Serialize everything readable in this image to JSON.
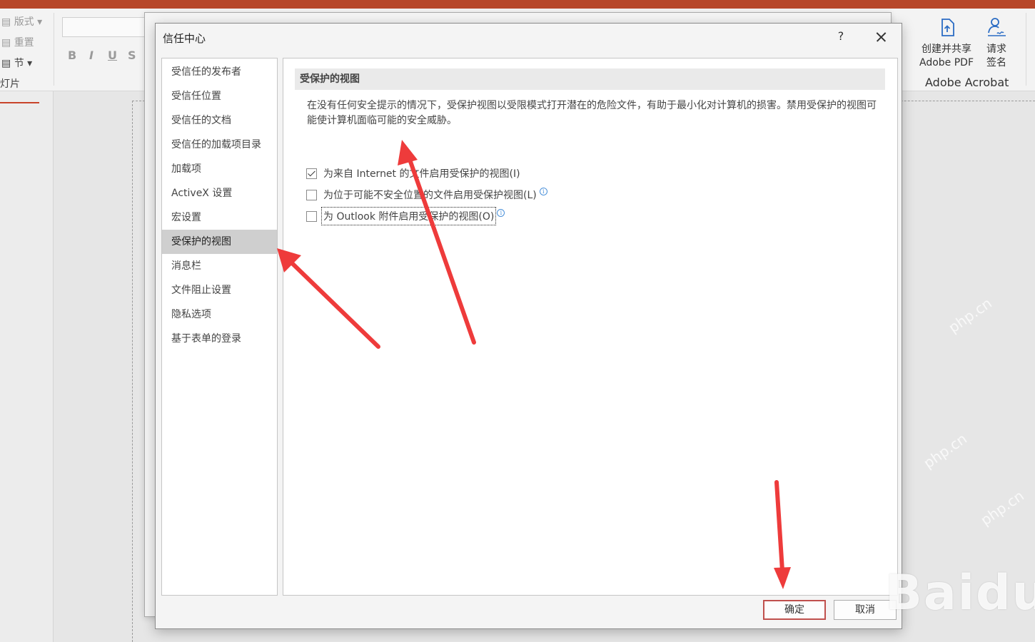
{
  "ribbon": {
    "layout_label": "版式",
    "reset_label": "重置",
    "section_label": "节",
    "slides_label": "灯片",
    "bold_label": "B",
    "italic_label": "I",
    "underline_label": "U",
    "strike_label": "S",
    "create_share_pdf": [
      "创建并共享",
      "Adobe PDF"
    ],
    "request_sign": [
      "请求",
      "签名"
    ],
    "acrobat_group": "Adobe Acrobat"
  },
  "dialog": {
    "title": "信任中心",
    "help": "?",
    "nav_items": [
      "受信任的发布者",
      "受信任位置",
      "受信任的文档",
      "受信任的加载项目录",
      "加载项",
      "ActiveX 设置",
      "宏设置",
      "受保护的视图",
      "消息栏",
      "文件阻止设置",
      "隐私选项",
      "基于表单的登录"
    ],
    "active_nav": "受保护的视图",
    "section_title": "受保护的视图",
    "description": "在没有任何安全提示的情况下，受保护视图以受限模式打开潜在的危险文件，有助于最小化对计算机的损害。禁用受保护的视图可能使计算机面临可能的安全威胁。",
    "options": [
      {
        "label": "为来自 Internet 的文件启用受保护的视图(I)",
        "checked": true,
        "info": false
      },
      {
        "label": "为位于可能不安全位置的文件启用受保护视图(L)",
        "checked": false,
        "info": true
      },
      {
        "label": "为 Outlook 附件启用受保护的视图(O)",
        "checked": false,
        "info": true
      }
    ],
    "ok_label": "确定",
    "cancel_label": "取消"
  },
  "watermark": {
    "brand": "Baidu",
    "site": "php.cn"
  },
  "colors": {
    "accent_red": "#c0504d",
    "annotation_arrow": "#ee3b3b",
    "app_title_bar": "#b7472a"
  }
}
